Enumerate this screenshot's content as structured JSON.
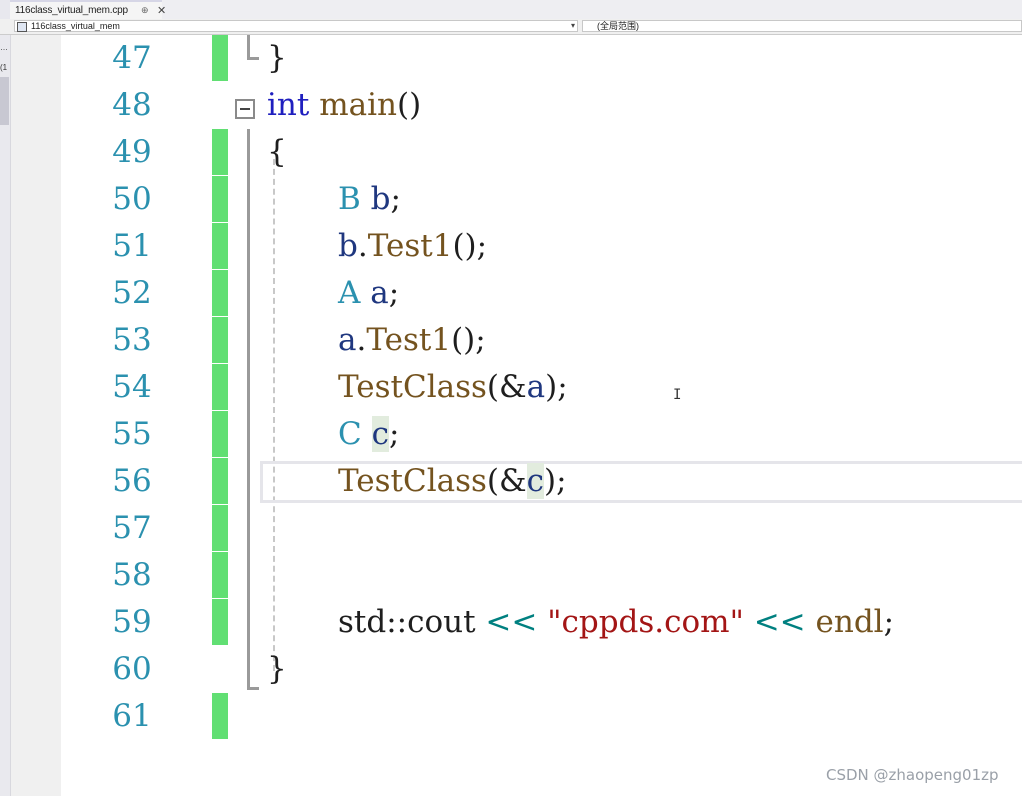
{
  "tab": {
    "title": "116class_virtual_mem.cpp",
    "pin_icon": "pin-icon",
    "close_glyph": "✕"
  },
  "nav": {
    "left": "116class_virtual_mem",
    "left_arrow": "▾",
    "right": "(全局范围)"
  },
  "left_strip": {
    "mark1": "…",
    "mark2": "(1"
  },
  "editor": {
    "lines": [
      {
        "num": "47"
      },
      {
        "num": "48"
      },
      {
        "num": "49"
      },
      {
        "num": "50"
      },
      {
        "num": "51"
      },
      {
        "num": "52"
      },
      {
        "num": "53"
      },
      {
        "num": "54"
      },
      {
        "num": "55"
      },
      {
        "num": "56"
      },
      {
        "num": "57"
      },
      {
        "num": "58"
      },
      {
        "num": "59"
      },
      {
        "num": "60"
      },
      {
        "num": "61"
      }
    ],
    "tokens": {
      "l47_brace": "}",
      "l48_kw": "int",
      "l48_fn": "main",
      "l48_paren": "()",
      "l49_brace": "{",
      "l50_cls": "B",
      "l50_var": "b",
      "l50_semi": ";",
      "l51_var": "b",
      "l51_dot": ".",
      "l51_fn": "Test1",
      "l51_rest": "();",
      "l52_cls": "A",
      "l52_var": "a",
      "l52_semi": ";",
      "l53_var": "a",
      "l53_dot": ".",
      "l53_fn": "Test1",
      "l53_rest": "();",
      "l54_fn": "TestClass",
      "l54_open": "(&",
      "l54_var": "a",
      "l54_close": ");",
      "l55_cls": "C",
      "l55_var": "c",
      "l55_semi": ";",
      "l56_fn": "TestClass",
      "l56_open": "(&",
      "l56_var": "c",
      "l56_close": ");",
      "l59_std": "std::cout",
      "l59_op1": "<<",
      "l59_str": "\"cppds.com\"",
      "l59_op2": "<<",
      "l59_endl": "endl",
      "l59_semi": ";",
      "l60_brace": "}"
    },
    "changed_lines": [
      "47",
      "49",
      "50",
      "51",
      "52",
      "53",
      "54",
      "55",
      "56",
      "57",
      "58",
      "59",
      "61"
    ]
  },
  "watermark": "CSDN @zhaopeng01zp",
  "colors": {
    "keyword": "#1f1fbf",
    "function": "#74531f",
    "class": "#2b91af",
    "variable": "#1f377f",
    "operator": "#008080",
    "string": "#a31515",
    "line_number": "#2b91af",
    "change_bar": "#61df73"
  }
}
